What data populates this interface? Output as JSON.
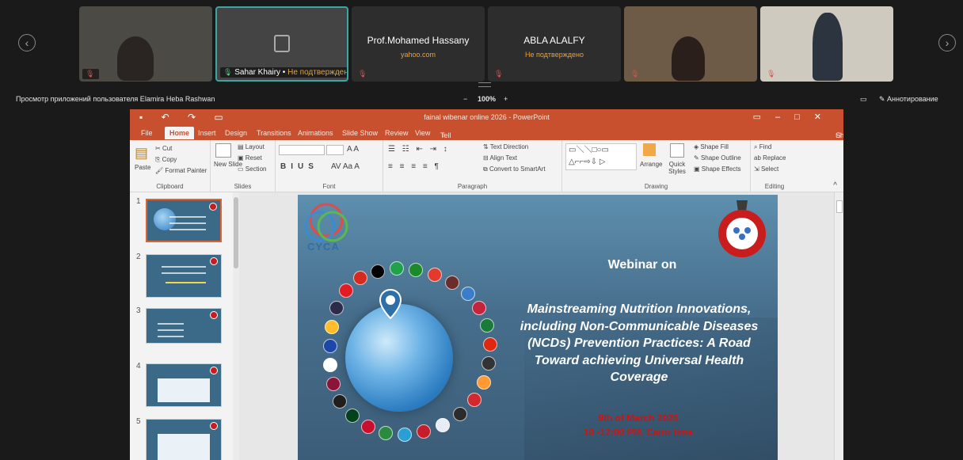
{
  "participants": [
    {
      "name": "",
      "status": ""
    },
    {
      "name": "Sahar Khairy",
      "status": "Не подтверждено"
    },
    {
      "name": "Prof.Mohamed Hassany",
      "sub": "yahoo.com"
    },
    {
      "name": "ABLA ALALFY",
      "sub": "Не подтверждено"
    },
    {
      "name": "",
      "status": ""
    },
    {
      "name": "",
      "status": ""
    }
  ],
  "viewer": {
    "title": "Просмотр приложений пользователя Elamira Heba Rashwan",
    "zoom_minus": "−",
    "zoom": "100%",
    "zoom_plus": "+",
    "annotate": "Аннотирование"
  },
  "ppt": {
    "window_title": "fainal wibenar online 2026 - PowerPoint",
    "tabs": [
      "File",
      "Home",
      "Insert",
      "Design",
      "Transitions",
      "Animations",
      "Slide Show",
      "Review",
      "View"
    ],
    "tell_me": "Tell me what you want to do...",
    "share": "Share",
    "ribbon": {
      "paste": "Paste",
      "cut": "Cut",
      "copy": "Copy",
      "format_painter": "Format Painter",
      "clipboard": "Clipboard",
      "new_slide": "New Slide",
      "layout": "Layout",
      "reset": "Reset",
      "section": "Section",
      "slides": "Slides",
      "font": "Font",
      "paragraph": "Paragraph",
      "text_direction": "Text Direction",
      "align_text": "Align Text",
      "convert_smartart": "Convert to SmartArt",
      "arrange": "Arrange",
      "quick_styles": "Quick Styles",
      "shape_fill": "Shape Fill",
      "shape_outline": "Shape Outline",
      "shape_effects": "Shape Effects",
      "drawing": "Drawing",
      "find": "Find",
      "replace": "Replace",
      "select": "Select",
      "editing": "Editing"
    },
    "thumb_numbers": [
      "1",
      "2",
      "3",
      "4",
      "5"
    ]
  },
  "slide": {
    "logo_text": "CYCA",
    "webinar": "Webinar on",
    "headline": "Mainstreaming Nutrition Innovations, including Non-Communicable Diseases (NCDs) Prevention Practices: A Road Toward achieving Universal Health Coverage",
    "date_line1": "9th of March 2026",
    "date_line2": "10 -12:00 PM, Cairo time"
  },
  "colors": {
    "ppt_accent": "#c8502e",
    "slide_bg": "#466e8c",
    "date_red": "#c81616",
    "status_orange": "#e8a23a"
  }
}
